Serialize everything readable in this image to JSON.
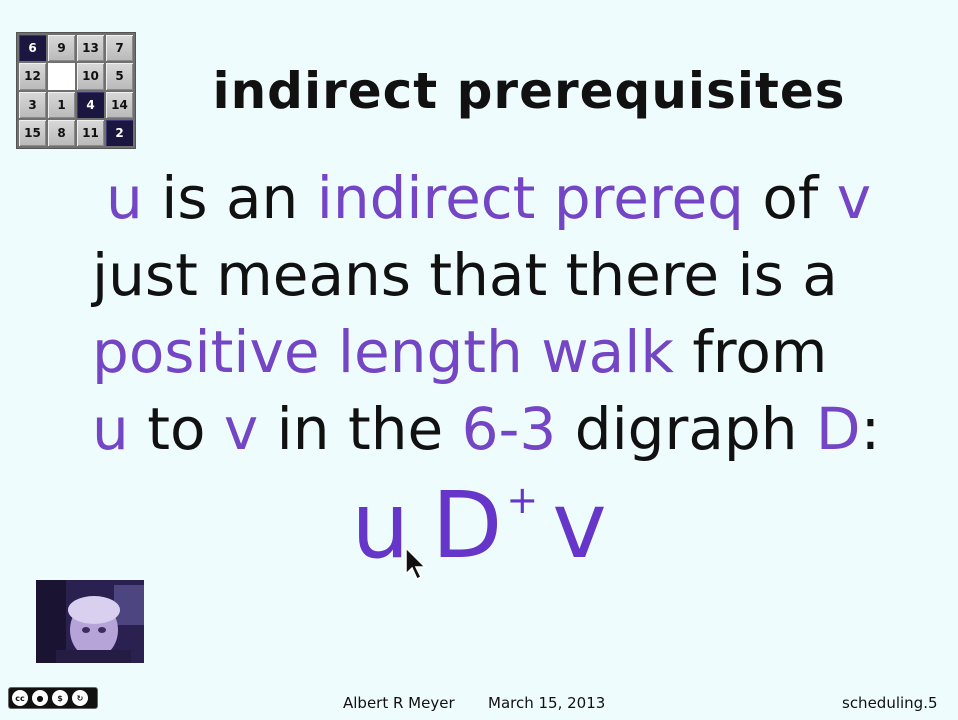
{
  "puzzle": {
    "tiles": [
      {
        "label": "6",
        "dark": true
      },
      {
        "label": "9",
        "dark": false
      },
      {
        "label": "13",
        "dark": false
      },
      {
        "label": "7",
        "dark": false
      },
      {
        "label": "12",
        "dark": false
      },
      {
        "label": "",
        "dark": false,
        "blank": true
      },
      {
        "label": "10",
        "dark": false
      },
      {
        "label": "5",
        "dark": false
      },
      {
        "label": "3",
        "dark": false
      },
      {
        "label": "1",
        "dark": false
      },
      {
        "label": "4",
        "dark": true
      },
      {
        "label": "14",
        "dark": false
      },
      {
        "label": "15",
        "dark": false
      },
      {
        "label": "8",
        "dark": false
      },
      {
        "label": "11",
        "dark": false
      },
      {
        "label": "2",
        "dark": true
      }
    ]
  },
  "title": "indirect prerequisites",
  "body": {
    "line1": {
      "u": "u",
      "is_an": " is an ",
      "indirect_prereq": "indirect prereq",
      "of": " of ",
      "v": "v"
    },
    "line2": "just means that there is a",
    "line3": {
      "walk": "positive length walk",
      "from": " from"
    },
    "line4": {
      "u": "u",
      "to": " to ",
      "v": "v",
      "in_the": " in the ",
      "digraph_id": "6-3",
      "digraph": " digraph ",
      "D": "D",
      "colon": ":"
    }
  },
  "formula": {
    "u": "u",
    "D": "D",
    "plus": "+",
    "v": "v"
  },
  "footer": {
    "author": "Albert R Meyer",
    "date": "March 15, 2013",
    "slide_id": "scheduling.5"
  },
  "colors": {
    "accent": "#7445c4",
    "background": "#eefcfd",
    "text": "#111111"
  }
}
